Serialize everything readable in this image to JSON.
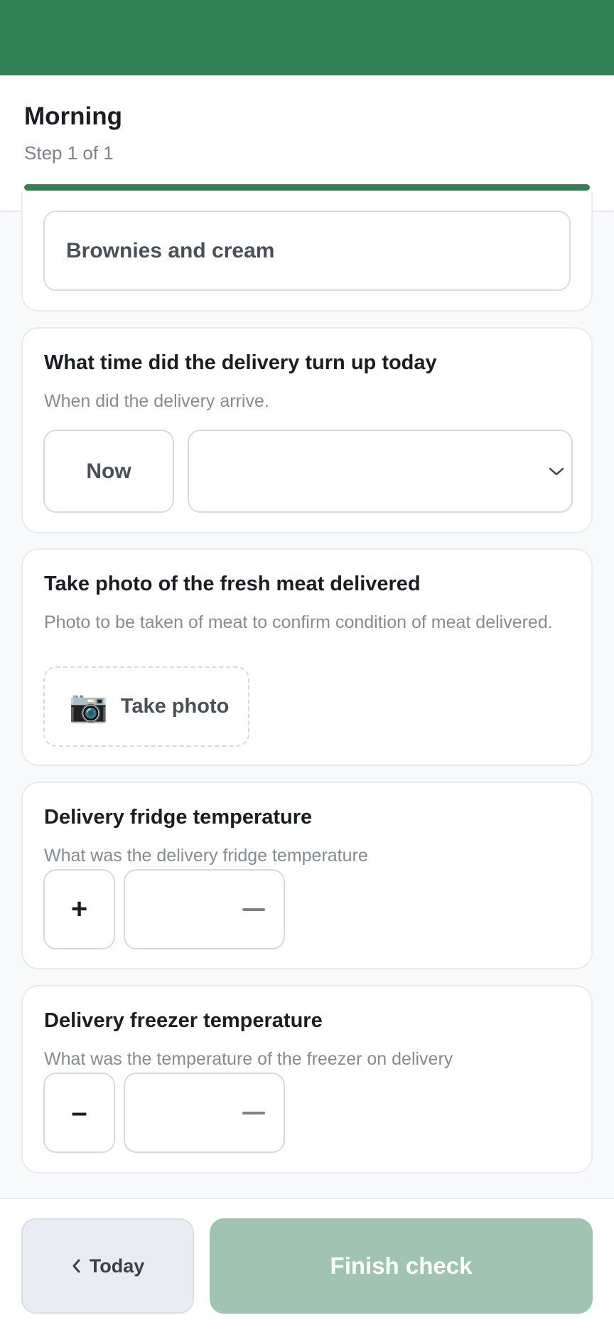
{
  "header": {
    "title": "Morning",
    "step": "Step 1 of 1",
    "progress": 1.0
  },
  "colors": {
    "brand": "#317f55",
    "finish_disabled": "#a1c4b2"
  },
  "previous_answer": {
    "value": "Brownies and cream"
  },
  "questions": [
    {
      "title": "What time did the delivery turn up today",
      "description": "When did the delivery arrive.",
      "now_label": "Now",
      "time_value": ""
    },
    {
      "title": "Take photo of the fresh meat delivered",
      "description": "Photo to be taken of meat to confirm condition of meat delivered.",
      "photo_label": "Take photo",
      "photo_icon": "camera-icon"
    },
    {
      "title": "Delivery fridge temperature",
      "description": "What was the delivery fridge temperature",
      "toggle_label": "+",
      "value": ""
    },
    {
      "title": "Delivery freezer temperature",
      "description": "What was the temperature of the freezer on delivery",
      "toggle_label": "–",
      "value": ""
    }
  ],
  "footer": {
    "back_icon": "chevron-left-icon",
    "back_label": "Today",
    "finish_label": "Finish check"
  }
}
